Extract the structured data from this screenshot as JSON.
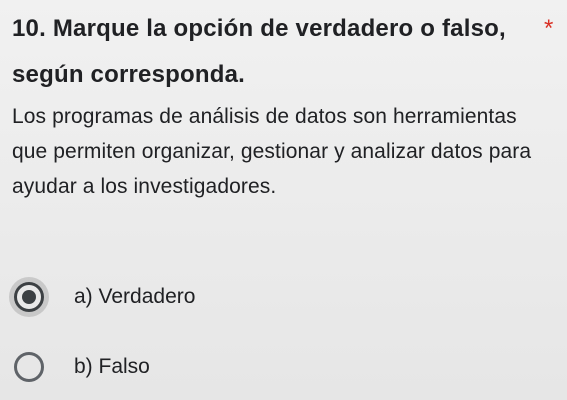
{
  "question": {
    "title": "10. Marque la opción de verdadero o falso,\nsegún corresponda.",
    "required_marker": "*",
    "description": "Los programas de análisis de datos son herramientas que permiten organizar, gestionar y analizar datos para ayudar a los investigadores."
  },
  "options": [
    {
      "label": "a) Verdadero",
      "selected": true
    },
    {
      "label": "b) Falso",
      "selected": false
    }
  ],
  "colors": {
    "required_star": "#d93025",
    "radio_selected": "#3c4043",
    "radio_border": "#5f6368"
  }
}
